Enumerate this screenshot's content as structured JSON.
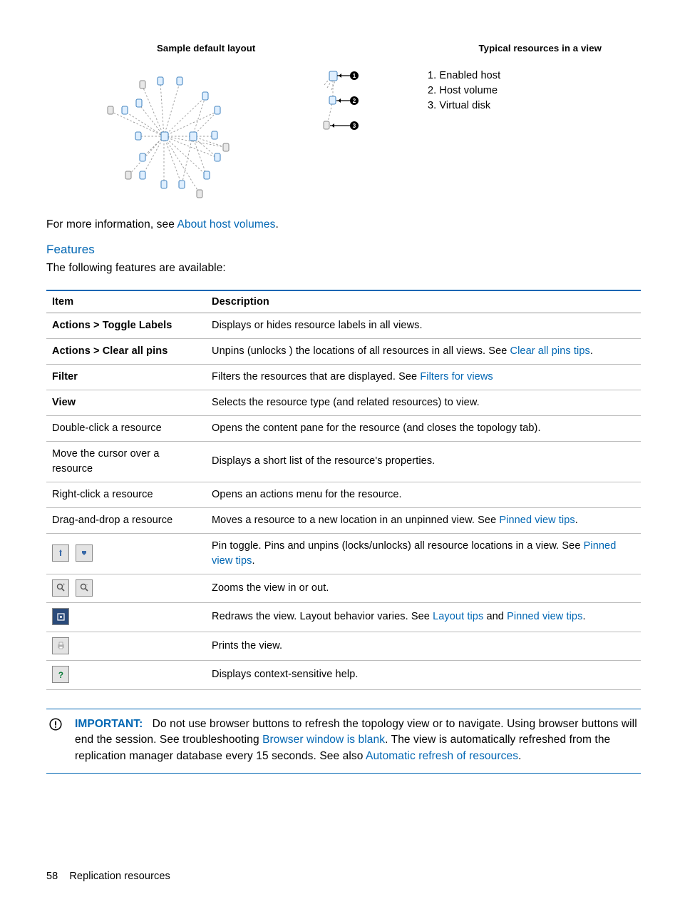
{
  "headers": {
    "left": "Sample default layout",
    "right": "Typical resources in a view"
  },
  "legend": {
    "l1": "1. Enabled host",
    "l2": "2. Host volume",
    "l3": "3. Virtual disk"
  },
  "intro1a": "For more information, see ",
  "intro1link": "About host volumes",
  "intro1b": ".",
  "featuresHeading": "Features",
  "intro2": "The following features are available:",
  "th": {
    "item": "Item",
    "desc": "Description"
  },
  "row": {
    "r1i": "Actions > Toggle Labels",
    "r1d": "Displays or hides resource labels in all views.",
    "r2i": "Actions > Clear all pins",
    "r2da": "Unpins (unlocks ) the locations of all resources in all views. See ",
    "r2dl": "Clear all pins tips",
    "r2db": ".",
    "r3i": "Filter",
    "r3da": "Filters the resources that are displayed. See ",
    "r3dl": "Filters for views",
    "r4i": "View",
    "r4d": "Selects the resource type (and related resources) to view.",
    "r5i": "Double-click a resource",
    "r5d": "Opens the content pane for the resource (and closes the topology tab).",
    "r6i": "Move the cursor over a resource",
    "r6d": "Displays a short list of the resource's properties.",
    "r7i": "Right-click a resource",
    "r7d": "Opens an actions menu for the resource.",
    "r8i": "Drag-and-drop a resource",
    "r8da": "Moves a resource to a new location in an unpinned view. See ",
    "r8dl": "Pinned view tips",
    "r8db": ".",
    "r9da": "Pin toggle. Pins and unpins (locks/unlocks) all resource locations in a view. See ",
    "r9dl": "Pinned view tips",
    "r9db": ".",
    "r10d": "Zooms the view in or out.",
    "r11da": "Redraws the view. Layout behavior varies. See ",
    "r11dl1": "Layout tips",
    "r11dmid": " and ",
    "r11dl2": "Pinned view tips",
    "r11db": ".",
    "r12d": "Prints the view.",
    "r13d": "Displays context-sensitive help."
  },
  "imp": {
    "label": "IMPORTANT:",
    "t1": "Do not use browser buttons to refresh the topology view or to navigate. Using browser buttons will end the session. See troubleshooting ",
    "l1": "Browser window is blank",
    "t2": ". The view is automatically refreshed from the replication manager database every 15 seconds. See also ",
    "l2": "Automatic refresh of resources",
    "t3": "."
  },
  "footer": {
    "page": "58",
    "title": "Replication resources"
  }
}
